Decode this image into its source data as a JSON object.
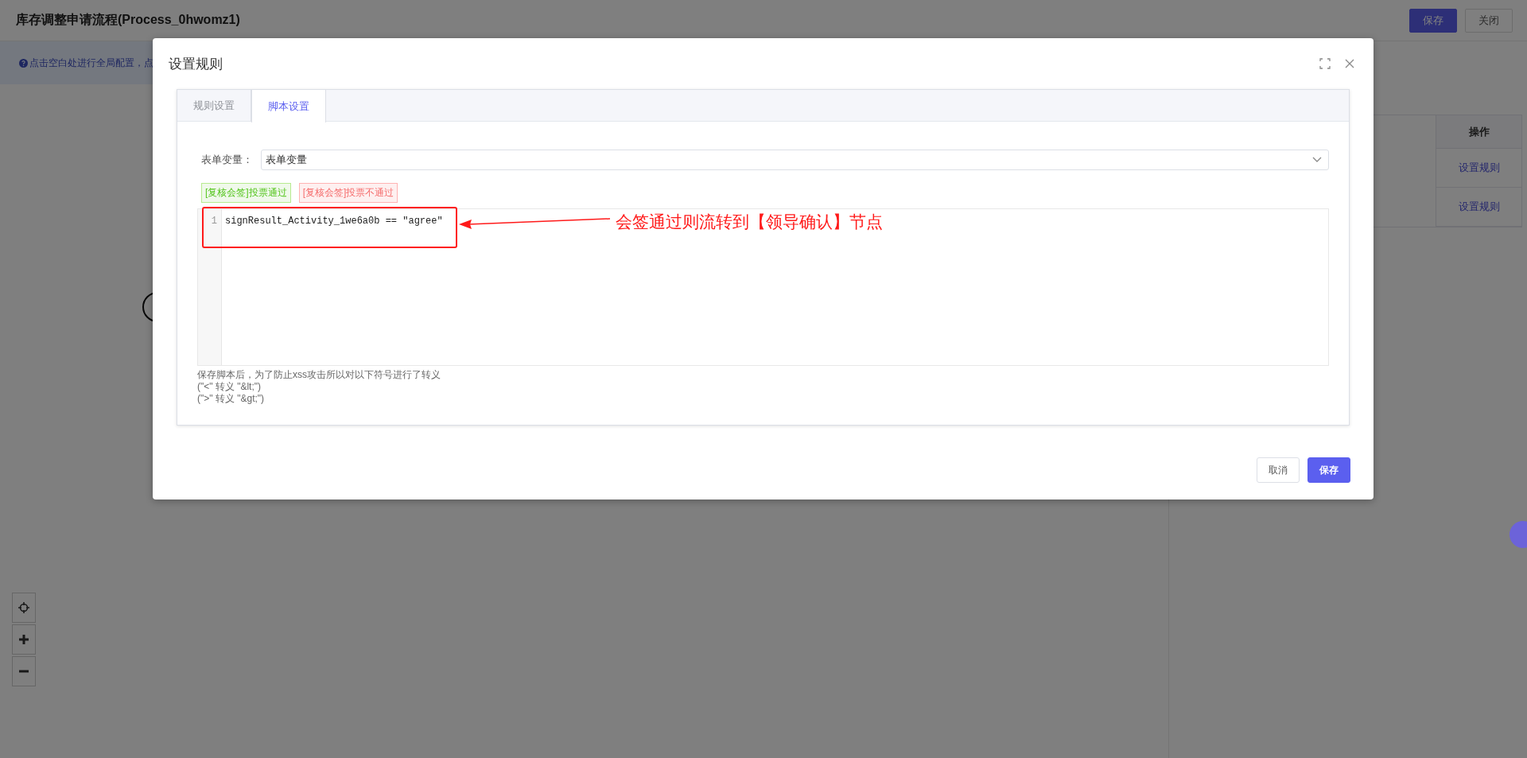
{
  "page": {
    "title": "库存调整申请流程(Process_0hwomz1)",
    "buttons": [
      {
        "label": "保存",
        "kind": "primary"
      },
      {
        "label": "关闭",
        "kind": "default"
      }
    ],
    "hint": "点击空白处进行全局配置，点"
  },
  "rules_table": {
    "header": "操作",
    "rows": [
      {
        "action": "设置规则"
      },
      {
        "action": "设置规则"
      }
    ]
  },
  "dialog": {
    "title": "设置规则",
    "tabs": [
      {
        "label": "规则设置",
        "selected": false
      },
      {
        "label": "脚本设置",
        "selected": true
      }
    ],
    "form_variable": {
      "label": "表单变量：",
      "value": "表单变量"
    },
    "tags": [
      {
        "label": "[复核会签]投票通过",
        "kind": "pass"
      },
      {
        "label": "[复核会签]投票不通过",
        "kind": "reject"
      }
    ],
    "code_lines": [
      {
        "number": "1",
        "text": "signResult_Activity_1we6a0b == \"agree\""
      }
    ],
    "note_lines": [
      "保存脚本后，为了防止xss攻击所以对以下符号进行了转义",
      "(\"<\" 转义 \"&lt;\")",
      "(\">\" 转义 \"&gt;\")"
    ],
    "buttons": [
      {
        "label": "取消",
        "kind": "default"
      },
      {
        "label": "保存",
        "kind": "primary"
      }
    ]
  },
  "annotation": {
    "text": "会签通过则流转到【领导确认】节点"
  }
}
